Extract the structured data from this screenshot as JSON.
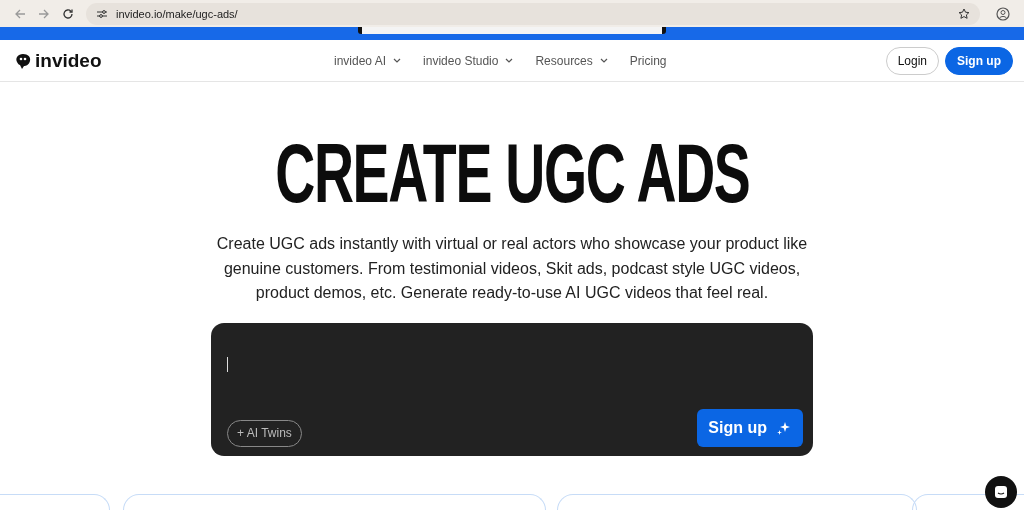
{
  "browser": {
    "url": "invideo.io/make/ugc-ads/"
  },
  "nav": {
    "logo": "invideo",
    "items": [
      {
        "label": "invideo AI",
        "dropdown": true
      },
      {
        "label": "invideo Studio",
        "dropdown": true
      },
      {
        "label": "Resources",
        "dropdown": true
      },
      {
        "label": "Pricing",
        "dropdown": false
      }
    ],
    "login": "Login",
    "signup": "Sign up"
  },
  "hero": {
    "title": "CREATE UGC ADS",
    "description": "Create UGC ads instantly with virtual or real actors who showcase your product like genuine customers. From testimonial videos, Skit ads, podcast style UGC videos, product demos, etc. Generate ready-to-use AI UGC videos that feel real."
  },
  "prompt": {
    "chip": "+ AI Twins",
    "button": "Sign up"
  }
}
